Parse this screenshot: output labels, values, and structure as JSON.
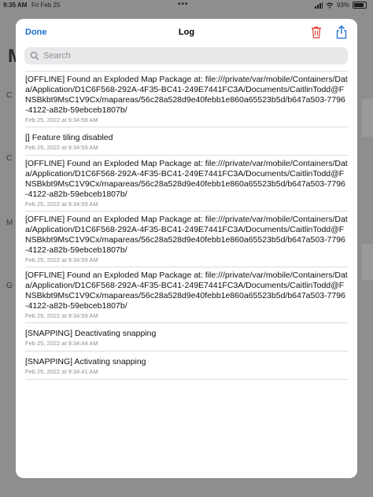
{
  "status_bar": {
    "time": "9:35 AM",
    "date": "Fri Feb 25",
    "battery": "93%"
  },
  "background": {
    "letter": "M",
    "side_labels": [
      "C",
      "C",
      "M",
      "G"
    ]
  },
  "sheet": {
    "done_label": "Done",
    "title": "Log",
    "search_placeholder": "Search",
    "accent_color": "#1a6fd1",
    "delete_color": "#e0463e"
  },
  "log_entries": [
    {
      "message": "[OFFLINE] Found an Exploded Map Package at: file:///private/var/mobile/Containers/Data/Application/D1C6F568-292A-4F35-BC41-249E7441FC3A/Documents/CaitlinTodd@FNSBkbt9MsC1V9Cx/mapareas/56c28a528d9e40febb1e860a65523b5d/b647a503-7796-4122-a82b-59ebceb1807b/",
      "timestamp": "Feb 25, 2022 at 9:34:59 AM"
    },
    {
      "message": "[] Feature tiling disabled",
      "timestamp": "Feb 25, 2022 at 9:34:59 AM"
    },
    {
      "message": "[OFFLINE] Found an Exploded Map Package at: file:///private/var/mobile/Containers/Data/Application/D1C6F568-292A-4F35-BC41-249E7441FC3A/Documents/CaitlinTodd@FNSBkbt9MsC1V9Cx/mapareas/56c28a528d9e40febb1e860a65523b5d/b647a503-7796-4122-a82b-59ebceb1807b/",
      "timestamp": "Feb 25, 2022 at 9:34:59 AM"
    },
    {
      "message": "[OFFLINE] Found an Exploded Map Package at: file:///private/var/mobile/Containers/Data/Application/D1C6F568-292A-4F35-BC41-249E7441FC3A/Documents/CaitlinTodd@FNSBkbt9MsC1V9Cx/mapareas/56c28a528d9e40febb1e860a65523b5d/b647a503-7796-4122-a82b-59ebceb1807b/",
      "timestamp": "Feb 25, 2022 at 9:34:59 AM"
    },
    {
      "message": "[OFFLINE] Found an Exploded Map Package at: file:///private/var/mobile/Containers/Data/Application/D1C6F568-292A-4F35-BC41-249E7441FC3A/Documents/CaitlinTodd@FNSBkbt9MsC1V9Cx/mapareas/56c28a528d9e40febb1e860a65523b5d/b647a503-7796-4122-a82b-59ebceb1807b/",
      "timestamp": "Feb 25, 2022 at 9:34:59 AM"
    },
    {
      "message": "[SNAPPING] Deactivating snapping",
      "timestamp": "Feb 25, 2022 at 9:34:44 AM"
    },
    {
      "message": "[SNAPPING] Activating snapping",
      "timestamp": "Feb 25, 2022 at 9:34:41 AM"
    }
  ]
}
